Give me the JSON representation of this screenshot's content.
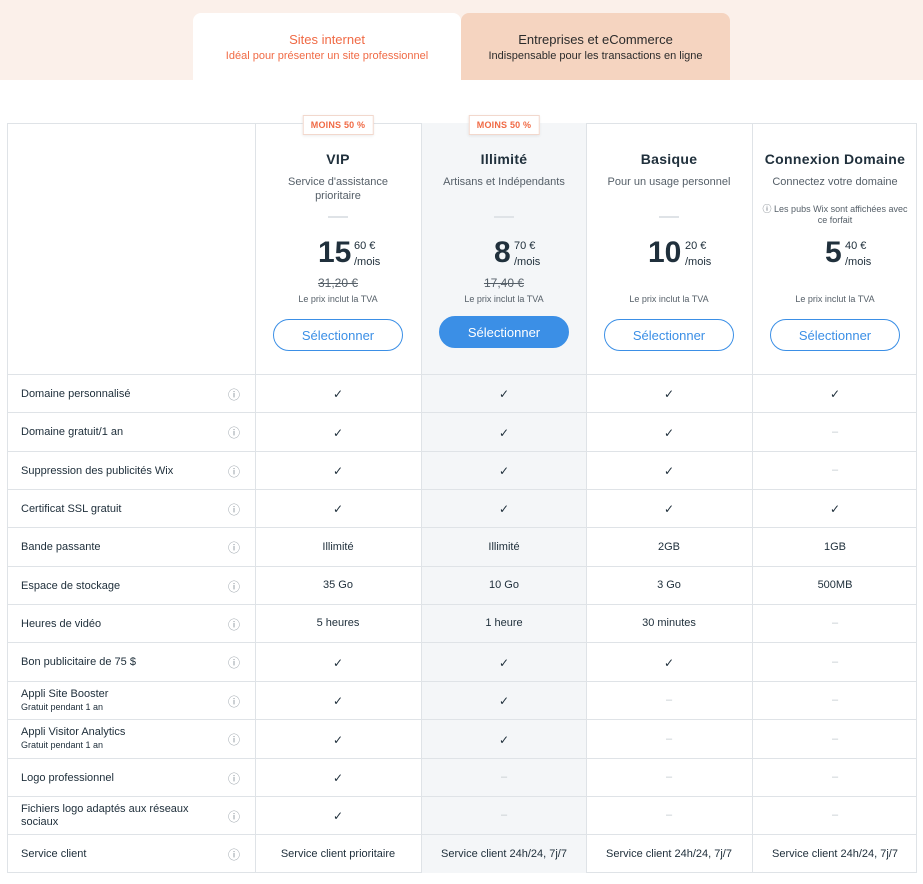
{
  "tabs": [
    {
      "title": "Sites internet",
      "subtitle": "Idéal pour présenter un site professionnel",
      "active": true
    },
    {
      "title": "Entreprises et eCommerce",
      "subtitle": "Indispensable pour les transactions en ligne",
      "active": false
    }
  ],
  "plans": [
    {
      "badge": "MOINS 50 %",
      "name": "VIP",
      "desc": "Service d'assistance prioritaire",
      "note": "",
      "price_int": "15",
      "price_dec": "60 €",
      "price_per": "/mois",
      "old_price": "31,20 €",
      "tva": "Le prix inclut la TVA",
      "button": "Sélectionner",
      "highlight": false
    },
    {
      "badge": "MOINS 50 %",
      "name": "Illimité",
      "desc": "Artisans et Indépendants",
      "note": "",
      "price_int": "8",
      "price_dec": "70 €",
      "price_per": "/mois",
      "old_price": "17,40 €",
      "tva": "Le prix inclut la TVA",
      "button": "Sélectionner",
      "highlight": true
    },
    {
      "badge": "",
      "name": "Basique",
      "desc": "Pour un usage personnel",
      "note": "",
      "price_int": "10",
      "price_dec": "20 €",
      "price_per": "/mois",
      "old_price": "",
      "tva": "Le prix inclut la TVA",
      "button": "Sélectionner",
      "highlight": false
    },
    {
      "badge": "",
      "name": "Connexion Domaine",
      "desc": "Connectez votre domaine",
      "note": "ⓘ Les pubs Wix sont affichées avec ce forfait",
      "price_int": "5",
      "price_dec": "40 €",
      "price_per": "/mois",
      "old_price": "",
      "tva": "Le prix inclut la TVA",
      "button": "Sélectionner",
      "highlight": false
    }
  ],
  "features": [
    {
      "label": "Domaine personnalisé",
      "sub": "",
      "values": [
        "✓",
        "✓",
        "✓",
        "✓"
      ]
    },
    {
      "label": "Domaine gratuit/1 an",
      "sub": "",
      "values": [
        "✓",
        "✓",
        "✓",
        "–"
      ]
    },
    {
      "label": "Suppression des publicités Wix",
      "sub": "",
      "values": [
        "✓",
        "✓",
        "✓",
        "–"
      ]
    },
    {
      "label": "Certificat SSL gratuit",
      "sub": "",
      "values": [
        "✓",
        "✓",
        "✓",
        "✓"
      ]
    },
    {
      "label": "Bande passante",
      "sub": "",
      "values": [
        "Illimité",
        "Illimité",
        "2GB",
        "1GB"
      ]
    },
    {
      "label": "Espace de stockage",
      "sub": "",
      "values": [
        "35 Go",
        "10 Go",
        "3 Go",
        "500MB"
      ]
    },
    {
      "label": "Heures de vidéo",
      "sub": "",
      "values": [
        "5 heures",
        "1 heure",
        "30 minutes",
        "–"
      ]
    },
    {
      "label": "Bon publicitaire de 75 $",
      "sub": "",
      "values": [
        "✓",
        "✓",
        "✓",
        "–"
      ]
    },
    {
      "label": "Appli Site Booster",
      "sub": "Gratuit pendant 1 an",
      "values": [
        "✓",
        "✓",
        "–",
        "–"
      ]
    },
    {
      "label": "Appli Visitor Analytics",
      "sub": "Gratuit pendant 1 an",
      "values": [
        "✓",
        "✓",
        "–",
        "–"
      ]
    },
    {
      "label": "Logo professionnel",
      "sub": "",
      "values": [
        "✓",
        "–",
        "–",
        "–"
      ]
    },
    {
      "label": "Fichiers logo adaptés aux réseaux sociaux",
      "sub": "",
      "values": [
        "✓",
        "–",
        "–",
        "–"
      ]
    },
    {
      "label": "Service client",
      "sub": "",
      "values": [
        "Service client prioritaire",
        "Service client 24h/24, 7j/7",
        "Service client 24h/24, 7j/7",
        "Service client 24h/24, 7j/7"
      ]
    }
  ],
  "info_icon": "ⓘ",
  "colors": {
    "accent": "#f06a45",
    "button_blue": "#3b8fe6",
    "highlight_col": "#f4f6f8",
    "top_band": "#fbf0ea"
  }
}
